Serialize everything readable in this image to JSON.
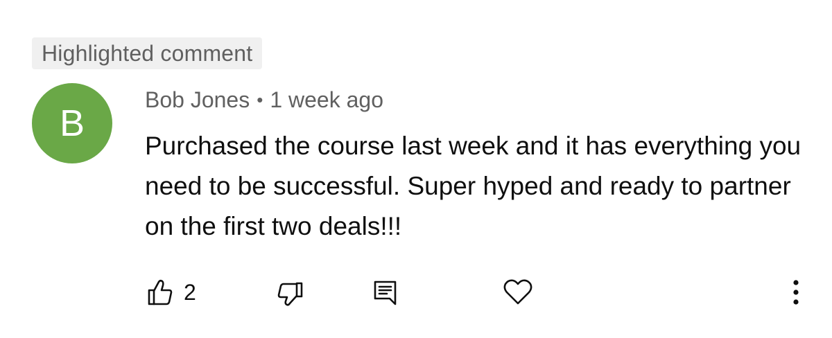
{
  "highlight_label": "Highlighted comment",
  "comment": {
    "avatar_letter": "B",
    "author": "Bob Jones",
    "separator": "•",
    "time": "1 week ago",
    "text": "Purchased the course last week and it has everything you need to be successful. Super hyped and ready to partner on the first two deals!!!"
  },
  "actions": {
    "like_icon": "thumbs-up-icon",
    "like_count": "2",
    "dislike_icon": "thumbs-down-icon",
    "reply_icon": "comment-icon",
    "heart_icon": "heart-icon",
    "more_icon": "more-vertical-icon"
  },
  "colors": {
    "avatar": "#6aa847",
    "meta_text": "#606060",
    "body_text": "#0f0f0f",
    "chip_bg": "#f0f0f0"
  }
}
